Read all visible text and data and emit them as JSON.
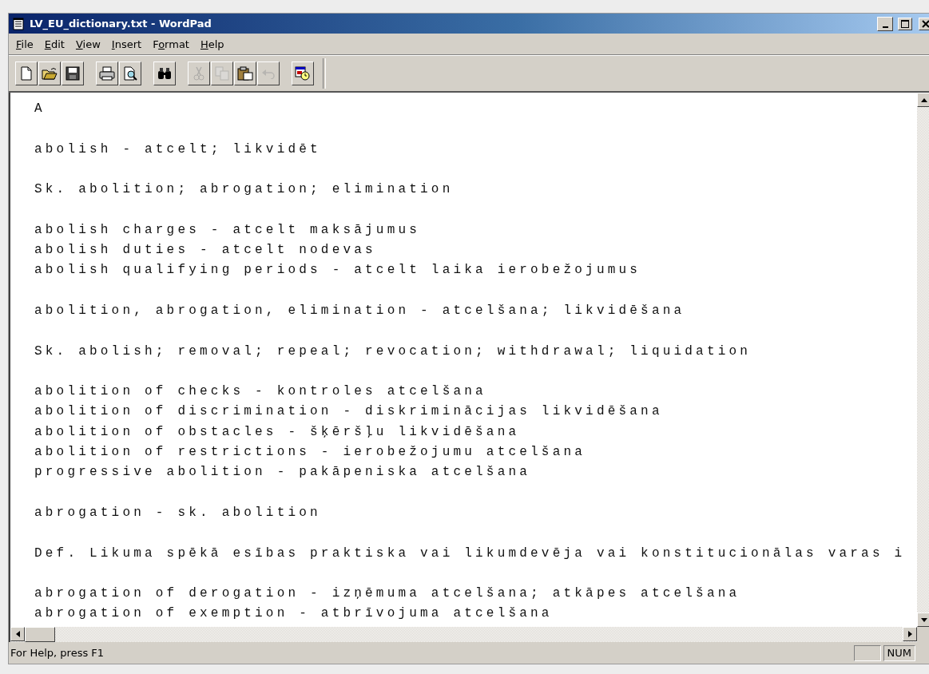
{
  "window": {
    "title": "LV_EU_dictionary.txt - WordPad",
    "controls": [
      {
        "kind": "minimize"
      },
      {
        "kind": "maximize"
      },
      {
        "kind": "close"
      }
    ]
  },
  "menu": [
    {
      "key": "F",
      "post": "ile"
    },
    {
      "key": "E",
      "post": "dit"
    },
    {
      "key": "V",
      "post": "iew"
    },
    {
      "key": "I",
      "post": "nsert"
    },
    {
      "pre": "F",
      "key": "o",
      "post": "rmat"
    },
    {
      "key": "H",
      "post": "elp"
    }
  ],
  "toolbar": [
    [
      {
        "kind": "new",
        "disabled": false
      },
      {
        "kind": "open",
        "disabled": false
      },
      {
        "kind": "save",
        "disabled": false
      }
    ],
    [
      {
        "kind": "print",
        "disabled": false
      },
      {
        "kind": "preview",
        "disabled": false
      }
    ],
    [
      {
        "kind": "find",
        "disabled": false
      }
    ],
    [
      {
        "kind": "cut",
        "disabled": true
      },
      {
        "kind": "copy",
        "disabled": true
      },
      {
        "kind": "paste",
        "disabled": false
      },
      {
        "kind": "undo",
        "disabled": true
      }
    ],
    [
      {
        "kind": "datetime",
        "disabled": false
      }
    ]
  ],
  "document": {
    "paragraphs": [
      [
        "A"
      ],
      [
        "abolish - atcelt; likvidēt"
      ],
      [
        "Sk. abolition; abrogation; elimination"
      ],
      [
        "abolish charges - atcelt maksājumus",
        "abolish duties - atcelt nodevas",
        "abolish qualifying periods - atcelt laika ierobežojumus"
      ],
      [
        "abolition, abrogation, elimination - atcelšana; likvidēšana"
      ],
      [
        "Sk. abolish; removal; repeal; revocation; withdrawal; liquidation"
      ],
      [
        "abolition of checks - kontroles atcelšana",
        "abolition of discrimination - diskriminācijas likvidēšana",
        "abolition of obstacles - šķēršļu likvidēšana",
        "abolition of restrictions - ierobežojumu atcelšana",
        "progressive abolition - pakāpeniska atcelšana"
      ],
      [
        "abrogation - sk. abolition"
      ],
      [
        "Def. Likuma spēkā esības praktiska vai likumdevēja vai konstitucionālas varas i"
      ],
      [
        "abrogation of derogation - izņēmuma atcelšana; atkāpes atcelšana",
        "abrogation of exemption - atbrīvojuma atcelšana"
      ]
    ]
  },
  "status_bar": {
    "text": "For Help, press F1",
    "panels": [
      {
        "kind": "blank"
      },
      {
        "kind": "text",
        "text": "NUM"
      }
    ]
  }
}
